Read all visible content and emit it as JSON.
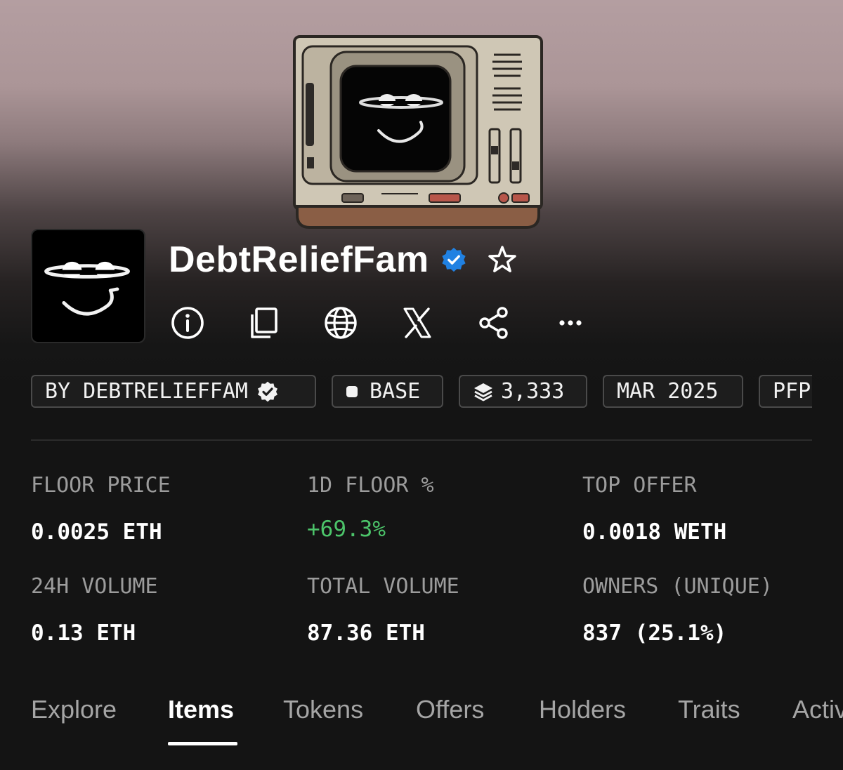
{
  "collection": {
    "name": "DebtReliefFam",
    "verified": true
  },
  "actions": [
    {
      "name": "info-icon"
    },
    {
      "name": "copy-icon"
    },
    {
      "name": "globe-icon"
    },
    {
      "name": "x-icon"
    },
    {
      "name": "share-icon"
    },
    {
      "name": "more-icon"
    }
  ],
  "pills": {
    "creator": "BY DEBTRELIEFFAM",
    "chain": "BASE",
    "supply": "3,333",
    "date": "MAR 2025",
    "category": "PFP"
  },
  "stats": {
    "floor_price": {
      "label": "FLOOR PRICE",
      "value": "0.0025 ETH"
    },
    "floor_change": {
      "label": "1D FLOOR %",
      "value": "+69.3%"
    },
    "top_offer": {
      "label": "TOP OFFER",
      "value": "0.0018 WETH"
    },
    "volume_24h": {
      "label": "24H VOLUME",
      "value": "0.13 ETH"
    },
    "total_volume": {
      "label": "TOTAL VOLUME",
      "value": "87.36 ETH"
    },
    "owners": {
      "label": "OWNERS (UNIQUE)",
      "value": "837 (25.1%)"
    }
  },
  "tabs": [
    {
      "label": "Explore",
      "active": false
    },
    {
      "label": "Items",
      "active": true
    },
    {
      "label": "Tokens",
      "active": false
    },
    {
      "label": "Offers",
      "active": false
    },
    {
      "label": "Holders",
      "active": false
    },
    {
      "label": "Traits",
      "active": false
    },
    {
      "label": "Activity",
      "active": false
    }
  ],
  "colors": {
    "background": "#141414",
    "verified_blue": "#2081e2",
    "positive_green": "#4cc46a",
    "muted_text": "#9c9c9c"
  }
}
